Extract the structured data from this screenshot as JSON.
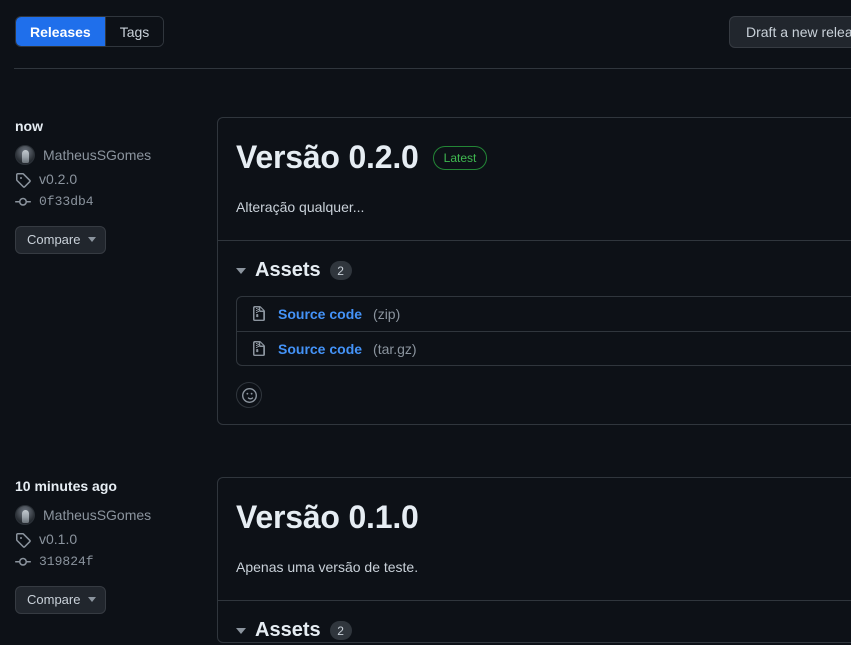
{
  "tabs": {
    "releases_label": "Releases",
    "tags_label": "Tags",
    "active": "Releases"
  },
  "draft_button": {
    "label": "Draft a new release"
  },
  "releases": [
    {
      "date": "now",
      "author": "MatheusSGomes",
      "tag": "v0.2.0",
      "commit": "0f33db4",
      "compare_label": "Compare",
      "title": "Versão 0.2.0",
      "badge": "Latest",
      "body": "Alteração qualquer...",
      "assets_label": "Assets",
      "assets_count": "2",
      "assets": [
        {
          "name": "Source code",
          "ext": "(zip)"
        },
        {
          "name": "Source code",
          "ext": "(tar.gz)"
        }
      ]
    },
    {
      "date": "10 minutes ago",
      "author": "MatheusSGomes",
      "tag": "v0.1.0",
      "commit": "319824f",
      "compare_label": "Compare",
      "title": "Versão 0.1.0",
      "badge": "",
      "body": "Apenas uma versão de teste.",
      "assets_label": "Assets",
      "assets_count": "2",
      "assets": []
    }
  ],
  "colors": {
    "page_background": "#0d1117",
    "border": "#30363d",
    "accent_blue": "#1f6feb",
    "link_blue": "#4493f8",
    "green_badge_border": "#238636",
    "green_badge_text": "#3fb950",
    "muted_text": "#8b949e",
    "primary_text": "#e6edf3"
  }
}
